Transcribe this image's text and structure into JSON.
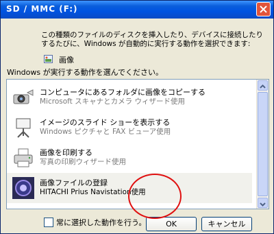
{
  "window": {
    "title": "SD / MMC (F:)"
  },
  "dialog": {
    "instruction": "この種類のファイルのディスクを挿入したり、デバイスに接続したりするたびに、Windows が自動的に実行する動作を選択できます:",
    "content_type_label": "画像",
    "prompt": "Windows が実行する動作を選んでください。",
    "actions": [
      {
        "title": "コンピュータにあるフォルダに画像をコピーする",
        "subtitle": "Microsoft スキャナとカメラ ウィザード使用",
        "icon": "camera-copy-icon"
      },
      {
        "title": "イメージのスライド ショーを表示する",
        "subtitle": "Windows ピクチャと FAX ビューア使用",
        "icon": "slideshow-icon"
      },
      {
        "title": "画像を印刷する",
        "subtitle": "写真の印刷ウィザード使用",
        "icon": "printer-icon"
      },
      {
        "title": "画像ファイルの登録",
        "subtitle": "HITACHI Prius Navistation使用",
        "icon": "prius-icon"
      }
    ],
    "always_checkbox_label": "常に選択した動作を行う。",
    "ok_label": "OK",
    "cancel_label": "キャンセル"
  },
  "colors": {
    "titlebar": "#0054E3",
    "dialog_bg": "#ECE9D8",
    "annotation_circle": "#E01010"
  }
}
